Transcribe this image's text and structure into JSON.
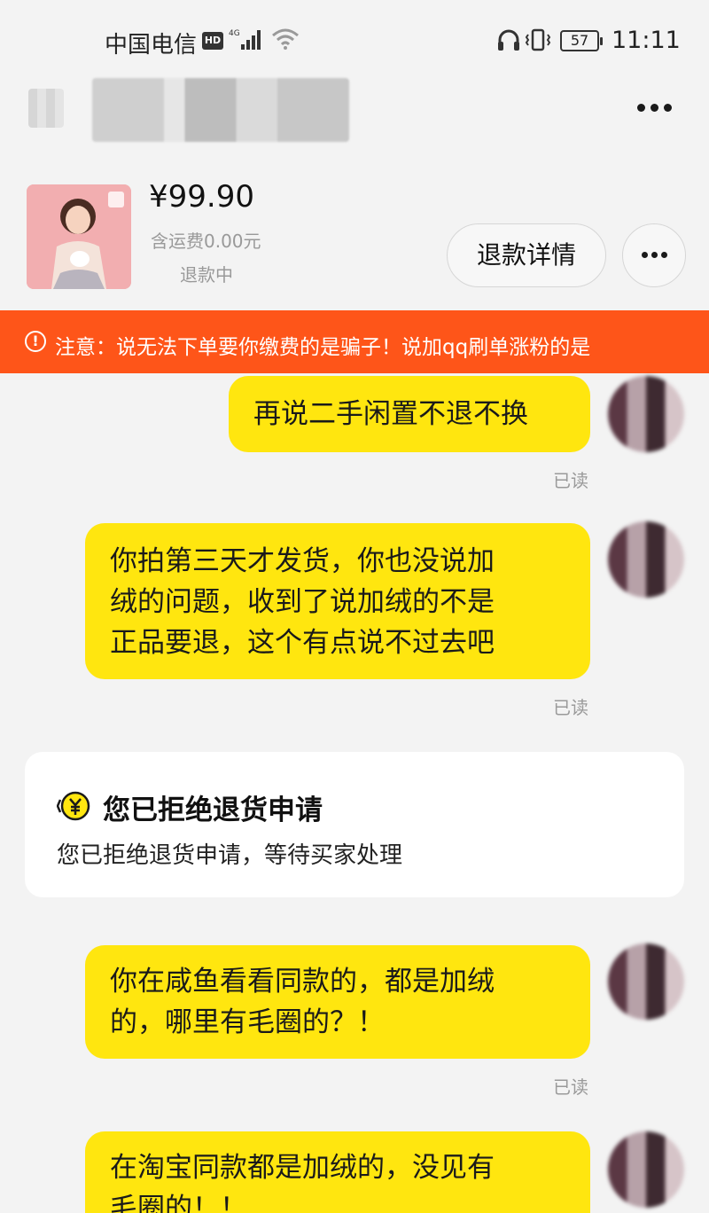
{
  "status_bar": {
    "carrier": "中国电信",
    "hd_badge": "HD",
    "network": "4G",
    "battery": "57",
    "time": "11:11"
  },
  "header": {
    "contact_name": "■■■■■■",
    "more_icon": "more-horizontal-icon"
  },
  "product": {
    "price": "¥99.90",
    "shipping": "含运费0.00元",
    "status": "退款中",
    "refund_detail_button": "退款详情",
    "more_icon": "more-horizontal-icon"
  },
  "warning": {
    "icon": "alert-circle-icon",
    "text": "注意：说无法下单要你缴费的是骗子！说加qq刷单涨粉的是"
  },
  "messages": [
    {
      "text": "再说二手闲置不退不换",
      "read": "已读"
    },
    {
      "text": "你拍第三天才发货，你也没说加绒的问题，收到了说加绒的不是正品要退，这个有点说不过去吧",
      "lines": [
        "你拍第三天才发货，你也没说加",
        "绒的问题，收到了说加绒的不是",
        "正品要退，这个有点说不过去吧"
      ],
      "read": "已读"
    },
    {
      "lines": [
        "你在咸鱼看看同款的，都是加绒",
        "的，哪里有毛圈的？！"
      ],
      "read": "已读"
    },
    {
      "lines": [
        "在淘宝同款都是加绒的，没见有",
        "毛圈的！！"
      ]
    }
  ],
  "system_card": {
    "icon": "refund-yen-icon",
    "title": "您已拒绝退货申请",
    "text": "您已拒绝退货申请，等待买家处理"
  },
  "colors": {
    "bubble": "#ffe60f",
    "warning_bg": "#fe5519",
    "background": "#f3f3f3"
  }
}
